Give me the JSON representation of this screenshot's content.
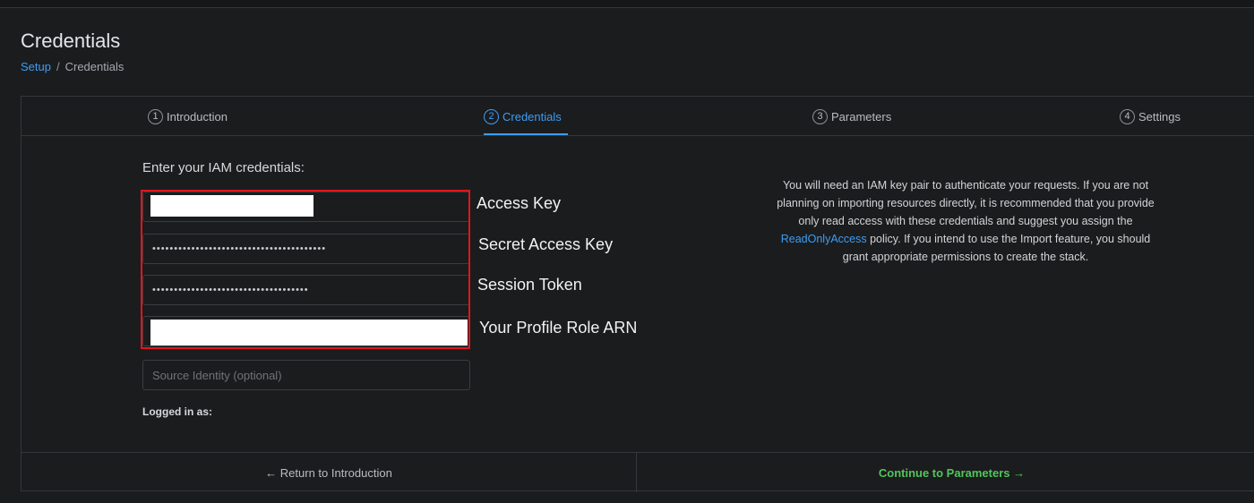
{
  "header": {
    "title": "Credentials",
    "breadcrumb": {
      "link": "Setup",
      "separator": "/",
      "current": "Credentials"
    }
  },
  "steps": [
    {
      "num": "1",
      "label": "Introduction"
    },
    {
      "num": "2",
      "label": "Credentials"
    },
    {
      "num": "3",
      "label": "Parameters"
    },
    {
      "num": "4",
      "label": "Settings"
    }
  ],
  "form": {
    "title": "Enter your IAM credentials:",
    "secret_mask": "••••••••••••••••••••••••••••••••••••••••",
    "token_mask": "••••••••••••••••••••••••••••••••••••",
    "source_placeholder": "Source Identity (optional)",
    "logged_in_label": "Logged in as:"
  },
  "callouts": {
    "access_key": "Access Key",
    "secret_access_key": "Secret Access Key",
    "session_token": "Session Token",
    "role_arn": "Your Profile Role ARN"
  },
  "help": {
    "text_before": "You will need an IAM key pair to authenticate your requests. If you are not planning on importing resources directly, it is recommended that you provide only read access with these credentials and suggest you assign the ",
    "link": "ReadOnlyAccess",
    "text_after": " policy. If you intend to use the Import feature, you should grant appropriate permissions to create the stack."
  },
  "footer": {
    "back_label": "← Return to Introduction",
    "next_label": "Continue to Parameters →"
  },
  "colors": {
    "accent": "#3d9df5",
    "success": "#52c55a",
    "highlight": "#e0161c"
  }
}
